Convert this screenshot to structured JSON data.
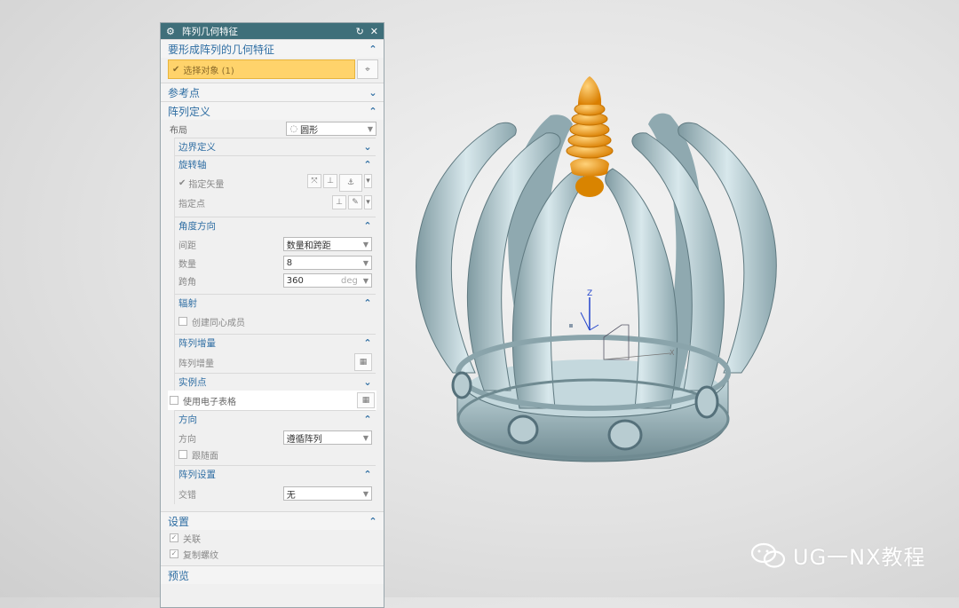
{
  "dialog": {
    "title": "阵列几何特征",
    "reset_icon": "reset-icon",
    "close_icon": "close-icon"
  },
  "features_group": {
    "label": "要形成阵列的几何特征",
    "select_label": "选择对象 (1)"
  },
  "ref_point_group": {
    "label": "参考点"
  },
  "array_def_group": {
    "label": "阵列定义",
    "layout_label": "布局",
    "layout_value": "圆形",
    "boundary": {
      "label": "边界定义"
    },
    "rotation_axis": {
      "label": "旋转轴",
      "vector_label": "指定矢量",
      "point_label": "指定点"
    },
    "angle_dir": {
      "label": "角度方向",
      "spacing_label": "间距",
      "spacing_value": "数量和跨距",
      "count_label": "数量",
      "count_value": "8",
      "span_label": "跨角",
      "span_value": "360",
      "span_unit": "deg"
    },
    "radiate": {
      "label": "辐射",
      "concentric_label": "创建同心成员"
    },
    "increment": {
      "label": "阵列增量",
      "inc_label": "阵列增量"
    },
    "instance_points": {
      "label": "实例点"
    },
    "spreadsheet_label": "使用电子表格",
    "direction": {
      "label": "方向",
      "dir_label": "方向",
      "dir_value": "遵循阵列",
      "follow_face_label": "跟随面"
    },
    "array_settings": {
      "label": "阵列设置",
      "stagger_label": "交错",
      "stagger_value": "无"
    }
  },
  "settings_group": {
    "label": "设置",
    "associative_label": "关联",
    "copy_threads_label": "复制螺纹"
  },
  "preview_group": {
    "label": "预览"
  },
  "viewport": {
    "triad_z_label": "Z",
    "triad_x_label": "X"
  },
  "watermark": {
    "text": "UG一NX教程"
  },
  "colors": {
    "title_bar": "#3f6f7a",
    "group_label": "#2f6ea3",
    "selection": "#ffd36b",
    "model_body": "#a9c2c8",
    "model_finial": "#f4a020"
  }
}
